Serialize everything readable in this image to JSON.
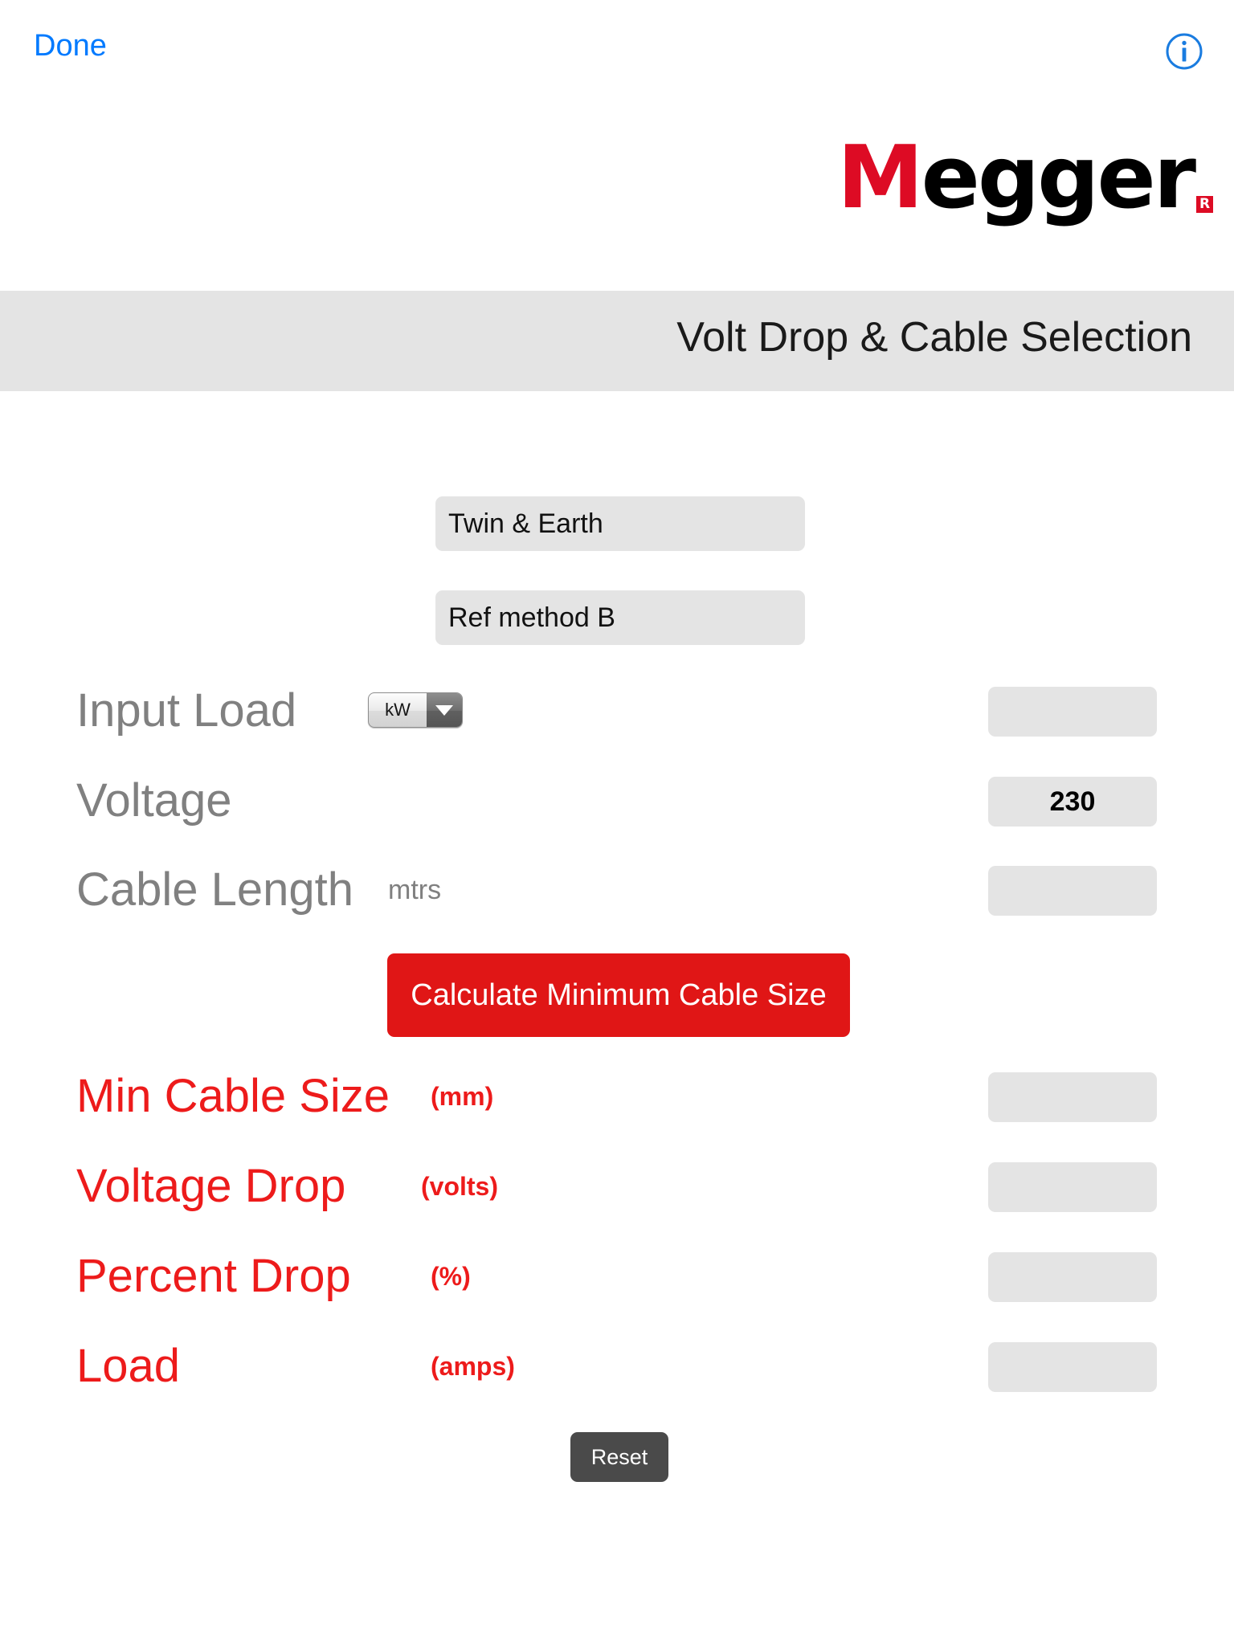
{
  "topbar": {
    "done_label": "Done",
    "info_icon": "info-circle-icon"
  },
  "brand": {
    "logo_first_letter": "M",
    "logo_rest": "egger",
    "registered_mark": "R",
    "accent_red": "#dd0b24"
  },
  "header": {
    "title": "Volt Drop & Cable Selection",
    "band_color": "#e4e4e4"
  },
  "selectors": [
    {
      "name": "cable-type",
      "value": "Twin & Earth"
    },
    {
      "name": "ref-method",
      "value": "Ref method B"
    }
  ],
  "inputs": [
    {
      "label": "Input Load",
      "unit": "",
      "unit_select": "kW",
      "value": ""
    },
    {
      "label": "Voltage",
      "unit": "",
      "value": "230"
    },
    {
      "label": "Cable Length",
      "unit": "mtrs",
      "value": ""
    }
  ],
  "actions": {
    "calculate_label": "Calculate Minimum Cable Size",
    "calculate_color": "#e01616",
    "reset_label": "Reset",
    "reset_color": "#4a4a4a"
  },
  "results": [
    {
      "label": "Min Cable Size",
      "unit": "(mm)",
      "value": ""
    },
    {
      "label": "Voltage Drop",
      "unit": "(volts)",
      "value": ""
    },
    {
      "label": "Percent Drop",
      "unit": "(%)",
      "value": ""
    },
    {
      "label": "Load",
      "unit": "(amps)",
      "value": ""
    }
  ],
  "colors": {
    "result_red": "#ed1b1b",
    "label_gray": "#808080",
    "field_gray": "#e4e4e4",
    "link_blue": "#007aff"
  }
}
